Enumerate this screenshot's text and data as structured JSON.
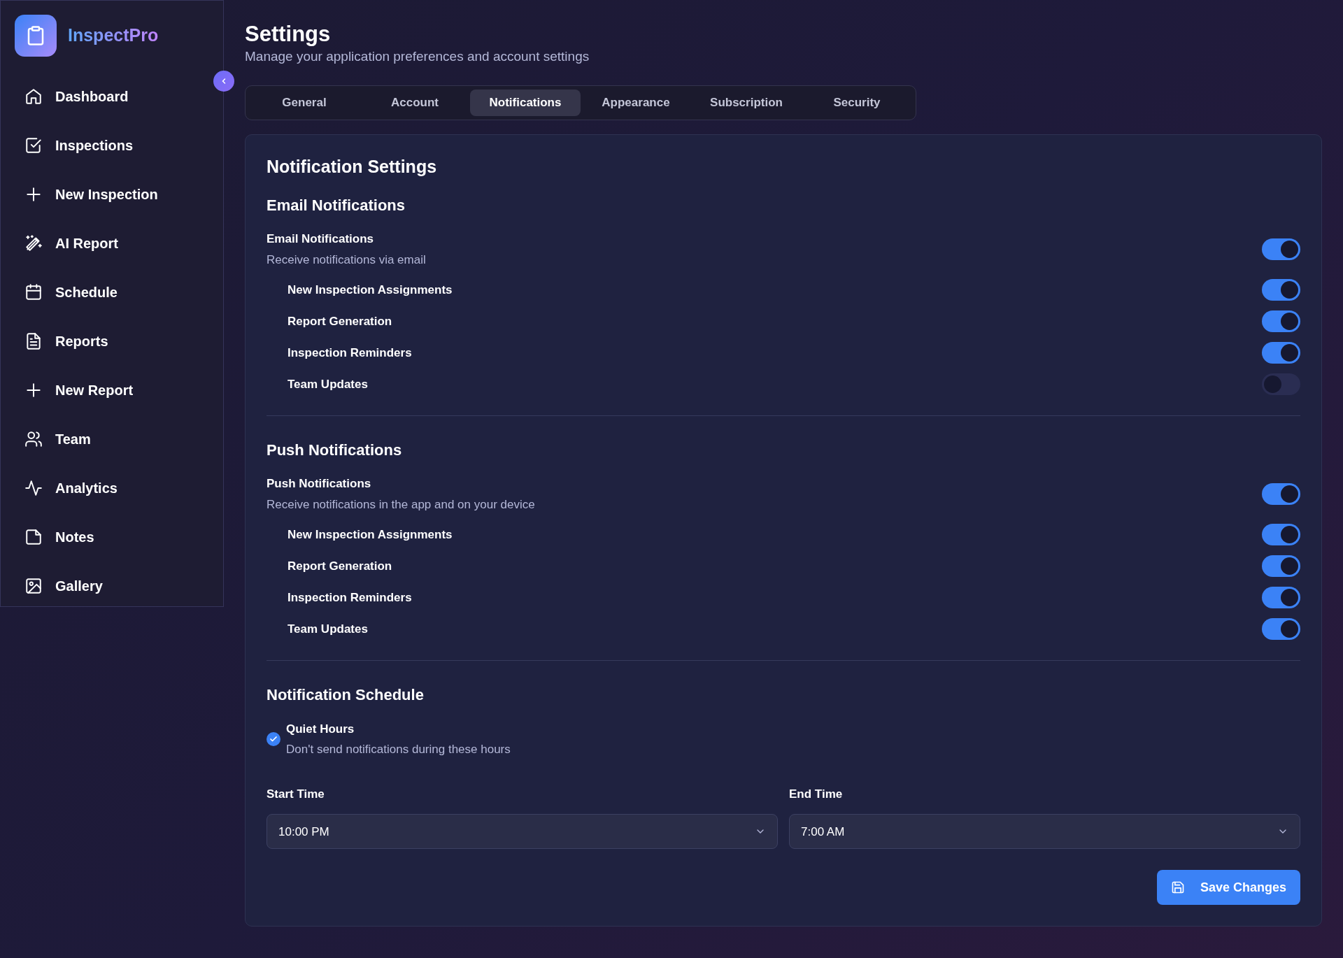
{
  "app": {
    "name": "InspectPro"
  },
  "sidebar": {
    "items": [
      {
        "label": "Dashboard"
      },
      {
        "label": "Inspections"
      },
      {
        "label": "New Inspection"
      },
      {
        "label": "AI Report"
      },
      {
        "label": "Schedule"
      },
      {
        "label": "Reports"
      },
      {
        "label": "New Report"
      },
      {
        "label": "Team"
      },
      {
        "label": "Analytics"
      },
      {
        "label": "Notes"
      },
      {
        "label": "Gallery"
      }
    ]
  },
  "page": {
    "title": "Settings",
    "subtitle": "Manage your application preferences and account settings"
  },
  "tabs": [
    {
      "label": "General",
      "selected": false
    },
    {
      "label": "Account",
      "selected": false
    },
    {
      "label": "Notifications",
      "selected": true
    },
    {
      "label": "Appearance",
      "selected": false
    },
    {
      "label": "Subscription",
      "selected": false
    },
    {
      "label": "Security",
      "selected": false
    }
  ],
  "card": {
    "title": "Notification Settings",
    "sections": [
      {
        "title": "Email Notifications",
        "master": {
          "label": "Email Notifications",
          "description": "Receive notifications via email",
          "on": true
        },
        "items": [
          {
            "label": "New Inspection Assignments",
            "on": true
          },
          {
            "label": "Report Generation",
            "on": true
          },
          {
            "label": "Inspection Reminders",
            "on": true
          },
          {
            "label": "Team Updates",
            "on": false
          }
        ]
      },
      {
        "title": "Push Notifications",
        "master": {
          "label": "Push Notifications",
          "description": "Receive notifications in the app and on your device",
          "on": true
        },
        "items": [
          {
            "label": "New Inspection Assignments",
            "on": true
          },
          {
            "label": "Report Generation",
            "on": true
          },
          {
            "label": "Inspection Reminders",
            "on": true
          },
          {
            "label": "Team Updates",
            "on": true
          }
        ]
      }
    ],
    "schedule": {
      "title": "Notification Schedule",
      "quiet_hours": {
        "label": "Quiet Hours",
        "description": "Don't send notifications during these hours",
        "checked": true
      },
      "start_time": {
        "label": "Start Time",
        "value": "10:00 PM"
      },
      "end_time": {
        "label": "End Time",
        "value": "7:00 AM"
      }
    },
    "save_button": "Save Changes"
  }
}
